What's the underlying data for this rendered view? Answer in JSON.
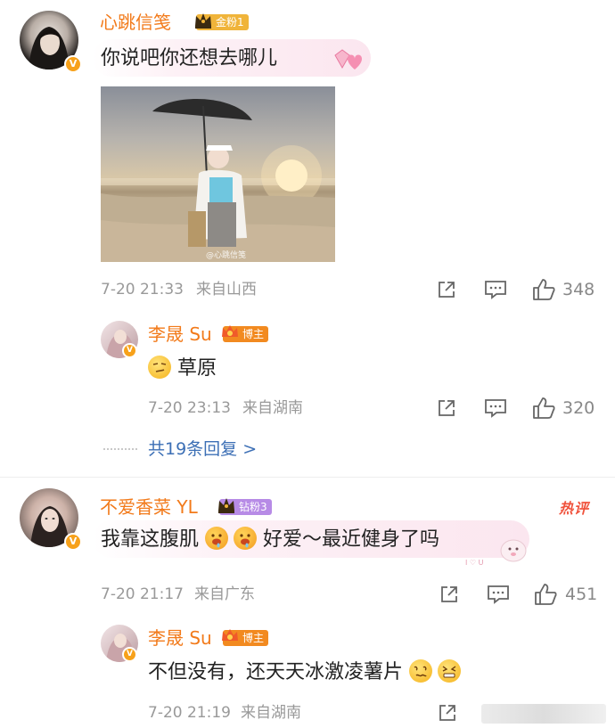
{
  "comments": [
    {
      "username": "心跳信笺",
      "fan_badge": "金粉1",
      "text": "你说吧你还想去哪儿",
      "image_watermark": "@心跳信笺",
      "time": "7-20 21:33",
      "location": "来自山西",
      "likes": "348",
      "reply": {
        "username": "李晟 Su",
        "badge": "博主",
        "text": "草原",
        "time": "7-20 23:13",
        "location": "来自湖南",
        "likes": "320"
      },
      "more_replies": "共19条回复 >"
    },
    {
      "username": "不爱香菜 YL",
      "fan_badge": "钻粉3",
      "hot_label": "热评",
      "text_part1": "我靠这腹肌",
      "text_part2": "好爱～最近健身了吗",
      "time": "7-20 21:17",
      "location": "来自广东",
      "likes": "451",
      "reply": {
        "username": "李晟 Su",
        "badge": "博主",
        "text": "不但没有，还天天冰激凌薯片",
        "time": "7-20 21:19",
        "location": "来自湖南"
      }
    }
  ],
  "colors": {
    "username": "#f27a1a",
    "link": "#3c6fb5",
    "meta": "#999999",
    "gold_badge": "#f0b43a",
    "diamond_badge": "#b78be6",
    "blogger_badge": "#f28a20",
    "hot": "#f0523c"
  },
  "icons": [
    "verified-v-icon",
    "share-icon",
    "comment-icon",
    "like-icon",
    "crown-icon"
  ]
}
